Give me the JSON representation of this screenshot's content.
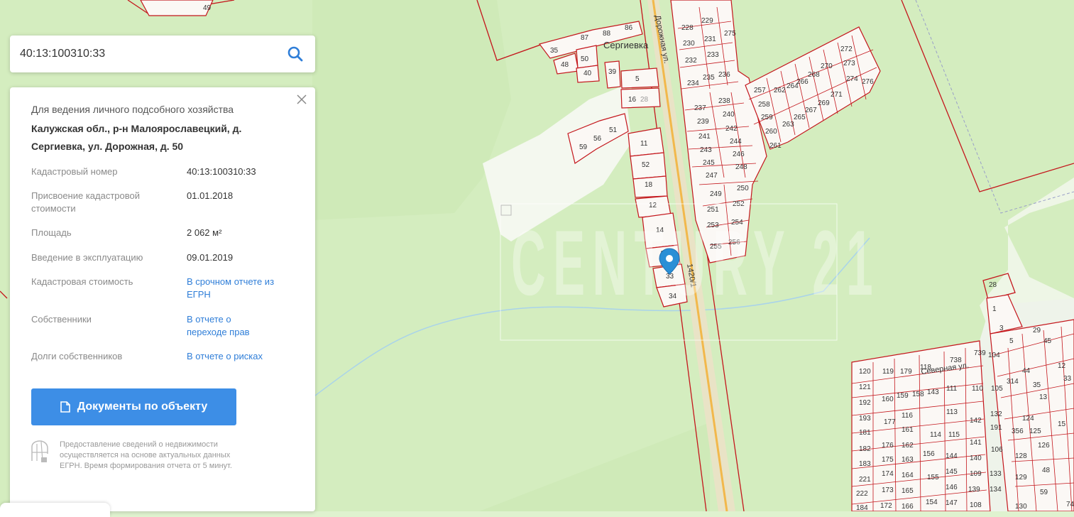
{
  "search": {
    "value": "40:13:100310:33"
  },
  "details": {
    "purpose": "Для ведения личного подсобного хозяйства",
    "address": "Калужская обл., р-н Малоярославецкий, д. Сергиевка, ул. Дорожная, д. 50",
    "rows": [
      {
        "label": "Кадастровый номер",
        "value": "40:13:100310:33",
        "link": false
      },
      {
        "label": "Присвоение кадастровой стоимости",
        "value": "01.01.2018",
        "link": false
      },
      {
        "label": "Площадь",
        "value": "2 062 м²",
        "link": false
      },
      {
        "label": "Введение в эксплуатацию",
        "value": "09.01.2019",
        "link": false
      },
      {
        "label": "Кадастровая стоимость",
        "value": "В срочном отчете из ЕГРН",
        "link": true
      },
      {
        "label": "Собственники",
        "value": "В отчете о переходе прав",
        "link": true
      },
      {
        "label": "Долги собственников",
        "value": "В отчете о рисках",
        "link": true
      }
    ],
    "docs_button": "Документы по объекту",
    "note": "Предоставление сведений о недвижимости осуществляется на основе актуальных данных ЕГРН. Время формирования отчета от 5 минут."
  },
  "map": {
    "village": "Сергиевка",
    "street": "Дорожная ул.",
    "street2": "Северная ул.",
    "road_number": "1420/1",
    "watermark": "CENTURY 21",
    "parcels_north": [
      "49",
      "87",
      "88",
      "86",
      "35",
      "48",
      "50",
      "40",
      "39",
      "5",
      "16",
      "28",
      "51",
      "56",
      "59",
      "11",
      "52",
      "18",
      "12",
      "14",
      "13",
      "33",
      "34"
    ],
    "parcels_east": [
      "228",
      "229",
      "230",
      "231",
      "232",
      "233",
      "234",
      "235",
      "236",
      "275",
      "237",
      "238",
      "239",
      "240",
      "241",
      "242",
      "243",
      "244",
      "245",
      "246",
      "247",
      "248",
      "249",
      "250",
      "251",
      "252",
      "253",
      "254",
      "255",
      "256",
      "257",
      "258",
      "259",
      "260",
      "261",
      "262",
      "263",
      "264",
      "265",
      "266",
      "267",
      "268",
      "269",
      "270",
      "271",
      "272",
      "273",
      "274",
      "276"
    ],
    "parcels_south": [
      "28",
      "1",
      "3",
      "29",
      "5",
      "45",
      "104",
      "44",
      "12",
      "35",
      "33",
      "13",
      "15",
      "124",
      "125",
      "126",
      "48",
      "59",
      "74",
      "738",
      "739",
      "118",
      "120",
      "119",
      "179",
      "121",
      "193",
      "160",
      "159",
      "158",
      "143",
      "111",
      "110",
      "142",
      "192",
      "181",
      "177",
      "176",
      "182",
      "175",
      "183",
      "174",
      "221",
      "173",
      "222",
      "184",
      "172",
      "116",
      "161",
      "162",
      "163",
      "164",
      "165",
      "166",
      "113",
      "115",
      "114",
      "155",
      "154",
      "156",
      "144",
      "145",
      "146",
      "147",
      "132",
      "191",
      "141",
      "140",
      "109",
      "139",
      "108",
      "133",
      "134",
      "106",
      "105",
      "128",
      "129",
      "130",
      "131",
      "314",
      "356",
      "106",
      "107",
      "112",
      "171"
    ]
  },
  "colors": {
    "parcel": "#c4161c",
    "accent": "#3d8ee6",
    "link": "#2f7ed8",
    "marker": "#2a8fd6"
  }
}
